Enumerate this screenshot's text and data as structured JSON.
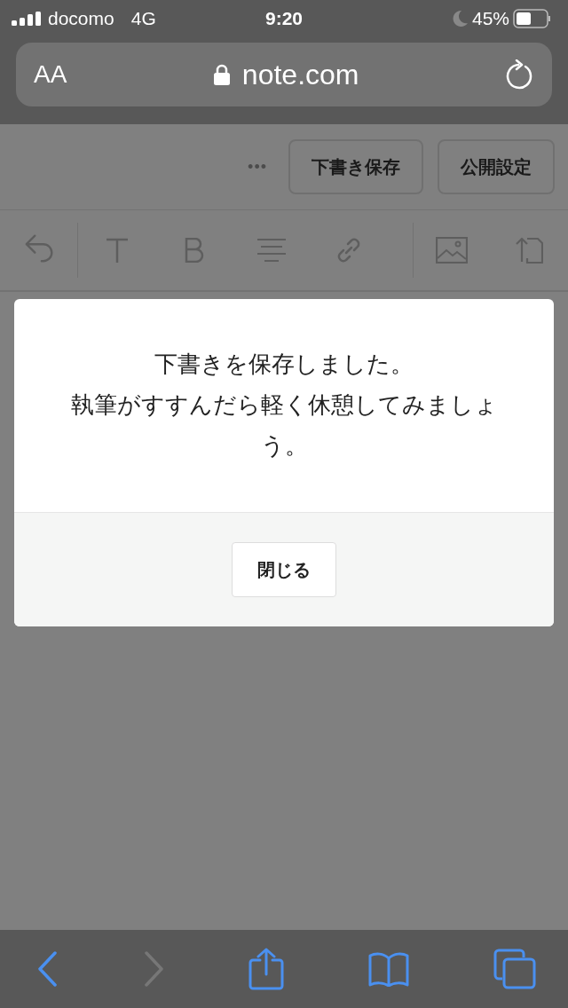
{
  "status_bar": {
    "carrier": "docomo",
    "network": "4G",
    "time": "9:20",
    "battery": "45%"
  },
  "url_bar": {
    "text_size": "AA",
    "url": "note.com"
  },
  "editor_header": {
    "more": "•••",
    "buttons": [
      "下書き保存",
      "公開設定"
    ]
  },
  "editor_toolbar": [
    {
      "kind": "undo"
    },
    {
      "kind": "text"
    },
    {
      "kind": "bold"
    },
    {
      "kind": "align"
    },
    {
      "kind": "link"
    },
    {
      "kind": "image"
    },
    {
      "kind": "embed"
    }
  ],
  "dialog": {
    "message": [
      "下書きを保存しました。",
      "執筆がすすんだら軽く休憩してみましょう。"
    ],
    "button": "閉じる"
  },
  "bottom_bar": [
    {
      "kind": "back",
      "disabled": false
    },
    {
      "kind": "forward",
      "disabled": true
    },
    {
      "kind": "share",
      "disabled": false
    },
    {
      "kind": "bookmarks",
      "disabled": false
    },
    {
      "kind": "tabs",
      "disabled": false
    }
  ]
}
